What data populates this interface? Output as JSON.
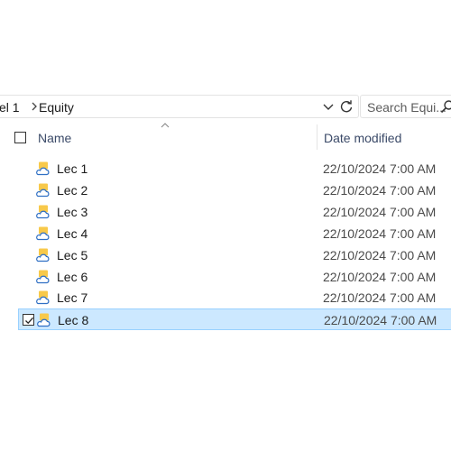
{
  "address": {
    "prev_crumb": "el 1",
    "current_crumb": "Equity"
  },
  "search": {
    "placeholder": "Search Equi..."
  },
  "columns": {
    "name": "Name",
    "date_modified": "Date modified"
  },
  "files": [
    {
      "name": "Lec 1",
      "date": "22/10/2024 7:00 AM",
      "selected": false
    },
    {
      "name": "Lec 2",
      "date": "22/10/2024 7:00 AM",
      "selected": false
    },
    {
      "name": "Lec 3",
      "date": "22/10/2024 7:00 AM",
      "selected": false
    },
    {
      "name": "Lec 4",
      "date": "22/10/2024 7:00 AM",
      "selected": false
    },
    {
      "name": "Lec 5",
      "date": "22/10/2024 7:00 AM",
      "selected": false
    },
    {
      "name": "Lec 6",
      "date": "22/10/2024 7:00 AM",
      "selected": false
    },
    {
      "name": "Lec 7",
      "date": "22/10/2024 7:00 AM",
      "selected": false
    },
    {
      "name": "Lec 8",
      "date": "22/10/2024 7:00 AM",
      "selected": true
    }
  ],
  "icons": {
    "folder": "cloud-folder-icon",
    "search": "search-icon",
    "refresh": "refresh-icon",
    "dropdown": "chevron-down-icon",
    "separator": "chevron-right-icon"
  },
  "colors": {
    "selection_bg": "#cce8ff",
    "selection_border": "#99d1ff",
    "folder_yellow": "#f8c94a",
    "cloud_blue": "#2f6fc4"
  }
}
